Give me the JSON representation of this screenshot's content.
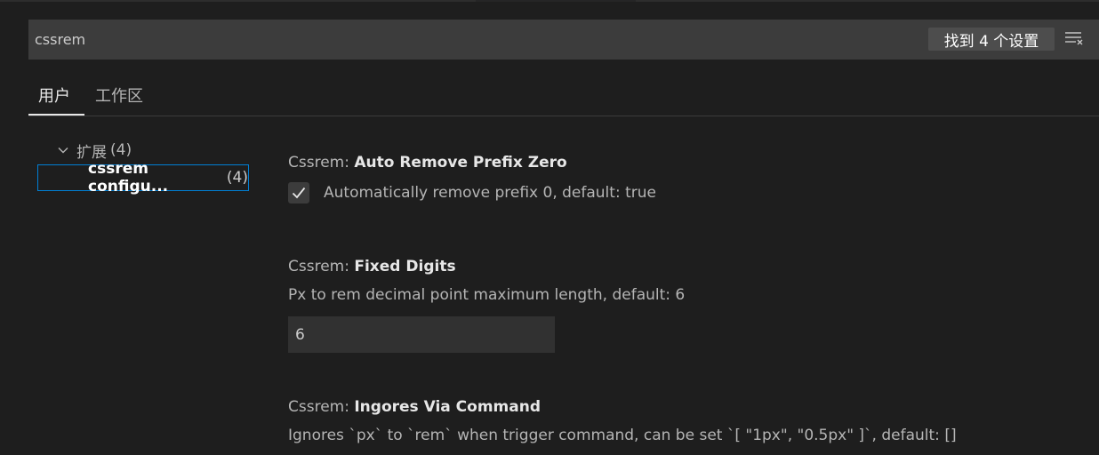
{
  "search": {
    "value": "cssrem",
    "result_count": "找到 4 个设置"
  },
  "tabs": [
    {
      "label": "用户",
      "active": true
    },
    {
      "label": "工作区",
      "active": false
    }
  ],
  "toc": {
    "group_label": "扩展",
    "group_count": "(4)",
    "item_label": "cssrem configu...",
    "item_count": "(4)"
  },
  "settings": [
    {
      "category": "Cssrem: ",
      "key": "Auto Remove Prefix Zero",
      "description": "Automatically remove prefix 0, default: true",
      "type": "checkbox",
      "checked": true
    },
    {
      "category": "Cssrem: ",
      "key": "Fixed Digits",
      "description": "Px to rem decimal point maximum length, default: 6",
      "type": "number",
      "value": "6"
    },
    {
      "category": "Cssrem: ",
      "key": "Ingores Via Command",
      "description": "Ignores `px` to `rem` when trigger command, can be set `[ \"1px\", \"0.5px\" ]`, default: []",
      "type": "array"
    }
  ],
  "icons": {
    "filter": "filter-clear-icon",
    "group_chevron": "chevron-down-icon",
    "check": "check-icon"
  },
  "colors": {
    "focus_border": "#007fd4",
    "background": "#1e1e1e",
    "input_background": "#3c3c3c"
  }
}
